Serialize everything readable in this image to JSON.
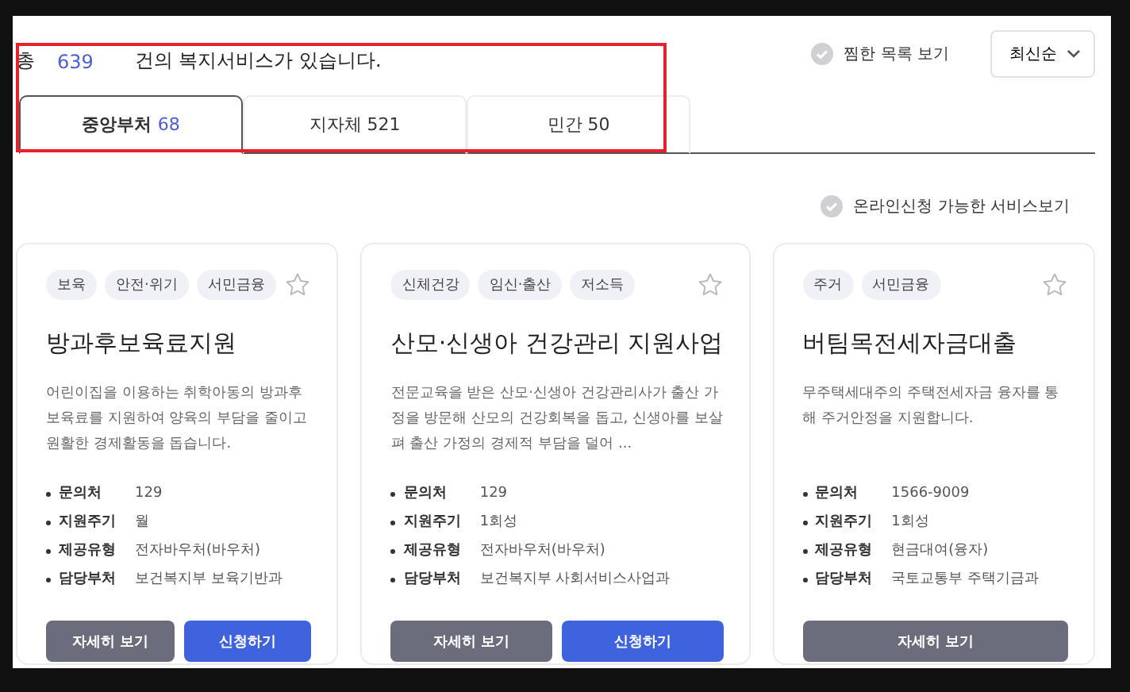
{
  "summary": {
    "prefix": "총",
    "count": "639",
    "suffix": "건의 복지서비스가 있습니다."
  },
  "favorites_toggle": {
    "label": "찜한 목록 보기",
    "checked": false
  },
  "sort": {
    "value": "최신순"
  },
  "tabs": [
    {
      "label": "중앙부처",
      "count": "68",
      "selected": true
    },
    {
      "label": "지자체",
      "count": "521",
      "selected": false
    },
    {
      "label": "민간",
      "count": "50",
      "selected": false
    }
  ],
  "online_filter": {
    "label": "온라인신청 가능한 서비스보기",
    "checked": false
  },
  "cards": [
    {
      "tags": [
        "보육",
        "안전·위기",
        "서민금융"
      ],
      "favorite": false,
      "title": "방과후보육료지원",
      "description": "어린이집을 이용하는 취학아동의 방과후 보육료를 지원하여  양육의 부담을 줄이고 원활한 경제활동을 돕습니다.",
      "info": [
        {
          "label": "문의처",
          "value": "129"
        },
        {
          "label": "지원주기",
          "value": "월"
        },
        {
          "label": "제공유형",
          "value": "전자바우처(바우처)"
        },
        {
          "label": "담당부처",
          "value": "보건복지부 보육기반과"
        }
      ],
      "buttons": [
        {
          "label": "자세히 보기",
          "kind": "detail"
        },
        {
          "label": "신청하기",
          "kind": "apply"
        }
      ]
    },
    {
      "tags": [
        "신체건강",
        "임신·출산",
        "저소득"
      ],
      "favorite": false,
      "title": "산모·신생아 건강관리 지원사업",
      "description": "전문교육을 받은 산모·신생아 건강관리사가 출산 가정을 방문해 산모의 건강회복을 돕고, 신생아를 보살펴 출산 가정의 경제적 부담을 덜어  ...",
      "info": [
        {
          "label": "문의처",
          "value": "129"
        },
        {
          "label": "지원주기",
          "value": "1회성"
        },
        {
          "label": "제공유형",
          "value": "전자바우처(바우처)"
        },
        {
          "label": "담당부처",
          "value": "보건복지부 사회서비스사업과"
        }
      ],
      "buttons": [
        {
          "label": "자세히 보기",
          "kind": "detail"
        },
        {
          "label": "신청하기",
          "kind": "apply"
        }
      ]
    },
    {
      "tags": [
        "주거",
        "서민금융"
      ],
      "favorite": false,
      "title": "버팀목전세자금대출",
      "description": "무주택세대주의 주택전세자금 융자를 통해 주거안정을 지원합니다.",
      "info": [
        {
          "label": "문의처",
          "value": "1566-9009"
        },
        {
          "label": "지원주기",
          "value": "1회성"
        },
        {
          "label": "제공유형",
          "value": "현금대여(융자)"
        },
        {
          "label": "담당부처",
          "value": "국토교통부 주택기금과"
        }
      ],
      "buttons": [
        {
          "label": "자세히 보기",
          "kind": "detail"
        }
      ]
    }
  ]
}
